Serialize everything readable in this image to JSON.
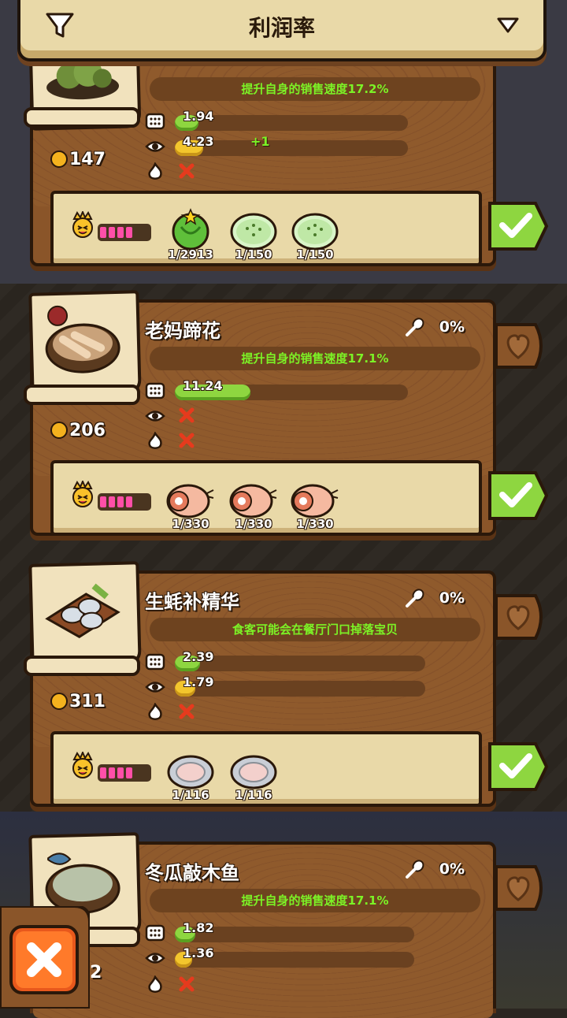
{
  "header": {
    "title": "利润率"
  },
  "cards": [
    {
      "name": "",
      "ratio": "",
      "effect": "提升自身的销售速度17.2%",
      "price": "147",
      "stats": {
        "speed": "1.94",
        "view": "4.23",
        "view_bonus": "+1"
      },
      "ingredients": [
        {
          "icon": "lettuce-icon",
          "count": "1/2913"
        },
        {
          "icon": "cucumber-slice-icon",
          "count": "1/150"
        },
        {
          "icon": "cucumber-slice-icon",
          "count": "1/150"
        }
      ]
    },
    {
      "name": "老妈蹄花",
      "ratio": "0%",
      "effect": "提升自身的销售速度17.1%",
      "price": "206",
      "stats": {
        "speed": "11.24"
      },
      "ingredients": [
        {
          "icon": "pork-leg-icon",
          "count": "1/330"
        },
        {
          "icon": "pork-leg-icon",
          "count": "1/330"
        },
        {
          "icon": "pork-leg-icon",
          "count": "1/330"
        }
      ]
    },
    {
      "name": "生蚝补精华",
      "ratio": "0%",
      "effect": "食客可能会在餐厅门口掉落宝贝",
      "price": "311",
      "stats": {
        "speed": "2.39",
        "view": "1.79"
      },
      "ingredients": [
        {
          "icon": "oyster-icon",
          "count": "1/116"
        },
        {
          "icon": "oyster-icon",
          "count": "1/116"
        }
      ]
    },
    {
      "name": "冬瓜敲木鱼",
      "ratio": "0%",
      "effect": "提升自身的销售速度17.1%",
      "price": "",
      "stats": {
        "speed": "1.82",
        "view": "1.36"
      },
      "ingredients": []
    }
  ],
  "close_count": "2",
  "colors": {
    "wood": "#8a5529",
    "parchment": "#e9d9a8",
    "effect_text": "#7cf226",
    "confirm": "#8ed640"
  }
}
